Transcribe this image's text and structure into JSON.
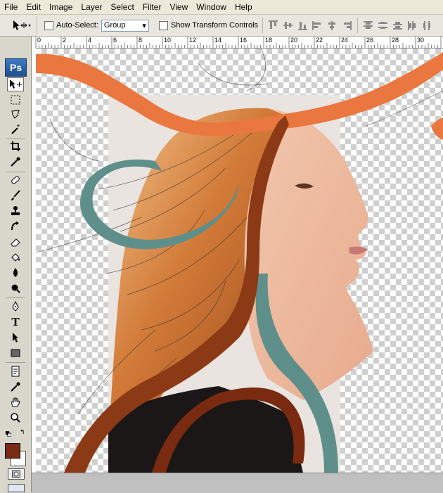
{
  "menu": [
    "File",
    "Edit",
    "Image",
    "Layer",
    "Select",
    "Filter",
    "View",
    "Window",
    "Help"
  ],
  "options_bar": {
    "auto_select_label": "Auto-Select:",
    "auto_select_value": "Group",
    "show_transform_label": "Show Transform Controls"
  },
  "toolbox": {
    "logo": "Ps",
    "tools": [
      "move-tool-icon",
      "marquee-tool-icon",
      "lasso-tool-icon",
      "magic-wand-icon",
      "crop-tool-icon",
      "eyedropper-icon",
      "healing-brush-icon",
      "brush-tool-icon",
      "clone-stamp-icon",
      "history-brush-icon",
      "eraser-icon",
      "paint-bucket-icon",
      "blur-tool-icon",
      "dodge-tool-icon",
      "pen-tool-icon",
      "type-tool-icon",
      "path-selection-icon",
      "shape-tool-icon",
      "notes-tool-icon",
      "eyedropper2-icon",
      "hand-tool-icon",
      "zoom-tool-icon"
    ],
    "type_label": "T",
    "foreground_color": "#7a2a14",
    "background_color": "#ffffff"
  },
  "ruler": {
    "top_labels": [
      "0",
      "2",
      "4",
      "6",
      "8",
      "10",
      "12",
      "14",
      "16",
      "18",
      "20",
      "22",
      "24",
      "26",
      "28",
      "30"
    ]
  },
  "colors": {
    "orange_ribbon": "#e9773f",
    "teal_swirl": "#5f8f8a",
    "rust_curve": "#8c3a16",
    "dark_curve": "#7a2a10"
  }
}
